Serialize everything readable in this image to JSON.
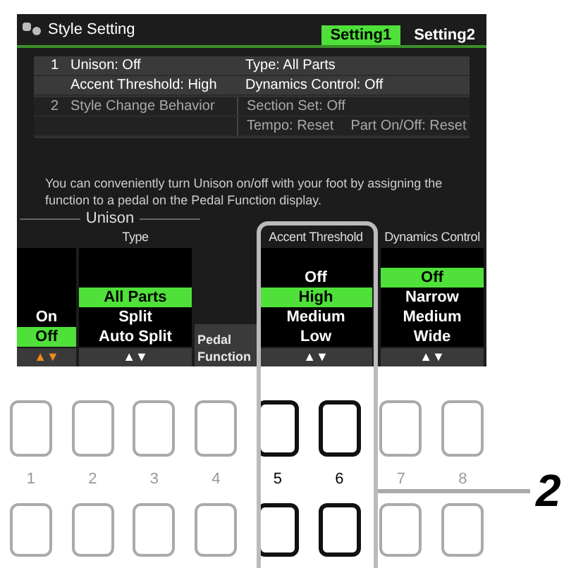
{
  "window": {
    "title": "Style Setting"
  },
  "tabs": [
    {
      "label": "Setting1",
      "selected": true
    },
    {
      "label": "Setting2",
      "selected": false
    }
  ],
  "settings": [
    {
      "number": "1",
      "selected": true,
      "lines": [
        {
          "label": "Unison: Off",
          "values": [
            "Type: All Parts"
          ]
        },
        {
          "label": "Accent Threshold: High",
          "values": [
            "Dynamics Control: Off"
          ]
        }
      ]
    },
    {
      "number": "2",
      "selected": false,
      "lines": [
        {
          "label": "Style Change Behavior",
          "values": [
            "Section Set: Off"
          ]
        },
        {
          "values": [
            "Tempo: Reset",
            "Part On/Off: Reset"
          ]
        }
      ]
    }
  ],
  "message": "You can conveniently turn Unison on/off with your foot by assigning the function to a pedal on the Pedal Function display.",
  "group_label": "Unison",
  "columns": [
    {
      "kind": "list",
      "active": true,
      "arrows": "▲▼",
      "items": [
        {
          "label": "On",
          "selected": false
        },
        {
          "label": "Off",
          "selected": true
        }
      ]
    },
    {
      "kind": "list",
      "active": false,
      "heading": "Type",
      "arrows": "▲▼",
      "items": [
        {
          "label": "All Parts",
          "selected": true
        },
        {
          "label": "Split",
          "selected": false
        },
        {
          "label": "Auto Split",
          "selected": false
        }
      ]
    },
    {
      "kind": "button",
      "label": "Pedal Function"
    },
    {
      "kind": "list",
      "active": false,
      "heading": "Accent Threshold",
      "arrows": "▲▼",
      "items": [
        {
          "label": "Off",
          "selected": false
        },
        {
          "label": "High",
          "selected": true
        },
        {
          "label": "Medium",
          "selected": false
        },
        {
          "label": "Low",
          "selected": false
        }
      ]
    },
    {
      "kind": "list",
      "active": false,
      "heading": "Dynamics Control",
      "arrows": "▲▼",
      "items": [
        {
          "label": "Off",
          "selected": true
        },
        {
          "label": "Narrow",
          "selected": false
        },
        {
          "label": "Medium",
          "selected": false
        },
        {
          "label": "Wide",
          "selected": false
        }
      ]
    }
  ],
  "panel_buttons": [
    {
      "label": "1",
      "highlighted": false
    },
    {
      "label": "2",
      "highlighted": false
    },
    {
      "label": "3",
      "highlighted": false
    },
    {
      "label": "4",
      "highlighted": false
    },
    {
      "label": "5",
      "highlighted": true
    },
    {
      "label": "6",
      "highlighted": true
    },
    {
      "label": "7",
      "highlighted": false
    },
    {
      "label": "8",
      "highlighted": false
    }
  ],
  "callout": "2"
}
